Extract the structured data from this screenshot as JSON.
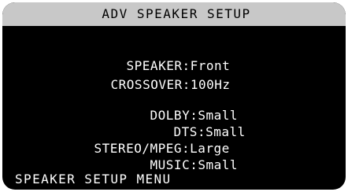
{
  "header": {
    "title": "ADV SPEAKER SETUP"
  },
  "settings": [
    {
      "label": "SPEAKER",
      "value": "Front"
    },
    {
      "label": "CROSSOVER",
      "value": "100Hz"
    },
    {
      "label": "DOLBY",
      "value": "Small"
    },
    {
      "label": "DTS",
      "value": "Small"
    },
    {
      "label": "STEREO/MPEG",
      "value": "Large"
    },
    {
      "label": "MUSIC",
      "value": "Small"
    }
  ],
  "separator": ":",
  "footer": {
    "menu_label": "SPEAKER SETUP MENU"
  },
  "colors": {
    "screen_bg": "#000000",
    "title_bar_bg": "#c8c8c8",
    "text": "#ffffff"
  }
}
